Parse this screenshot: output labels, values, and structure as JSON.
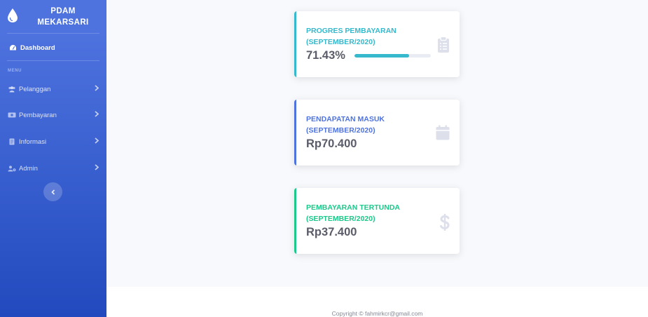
{
  "brand": {
    "name": "PDAM MEKARSARI"
  },
  "sidebar": {
    "dashboard_label": "Dashboard",
    "menu_heading": "MENU",
    "items": [
      {
        "label": "Pelanggan",
        "icon": "users-icon"
      },
      {
        "label": "Pembayaran",
        "icon": "money-bill-icon"
      },
      {
        "label": "Informasi",
        "icon": "file-icon"
      },
      {
        "label": "Admin",
        "icon": "user-cog-icon"
      }
    ],
    "toggle_icon": "chevron-left-icon"
  },
  "cards": [
    {
      "label": "PROGRES PEMBAYARAN (SEPTEMBER/2020)",
      "value": "71.43%",
      "progress": 0.7143,
      "color": "#36b9cc",
      "icon": "clipboard-list-icon"
    },
    {
      "label": "PENDAPATAN MASUK (SEPTEMBER/2020)",
      "value": "Rp70.400",
      "color": "#4e73df",
      "icon": "calendar-icon"
    },
    {
      "label": "PEMBAYARAN TERTUNDA (SEPTEMBER/2020)",
      "value": "Rp37.400",
      "color": "#1cc88a",
      "icon": "dollar-sign-icon"
    }
  ],
  "footer": {
    "copyright": "Copyright © fahmirkcr@gmail.com"
  }
}
